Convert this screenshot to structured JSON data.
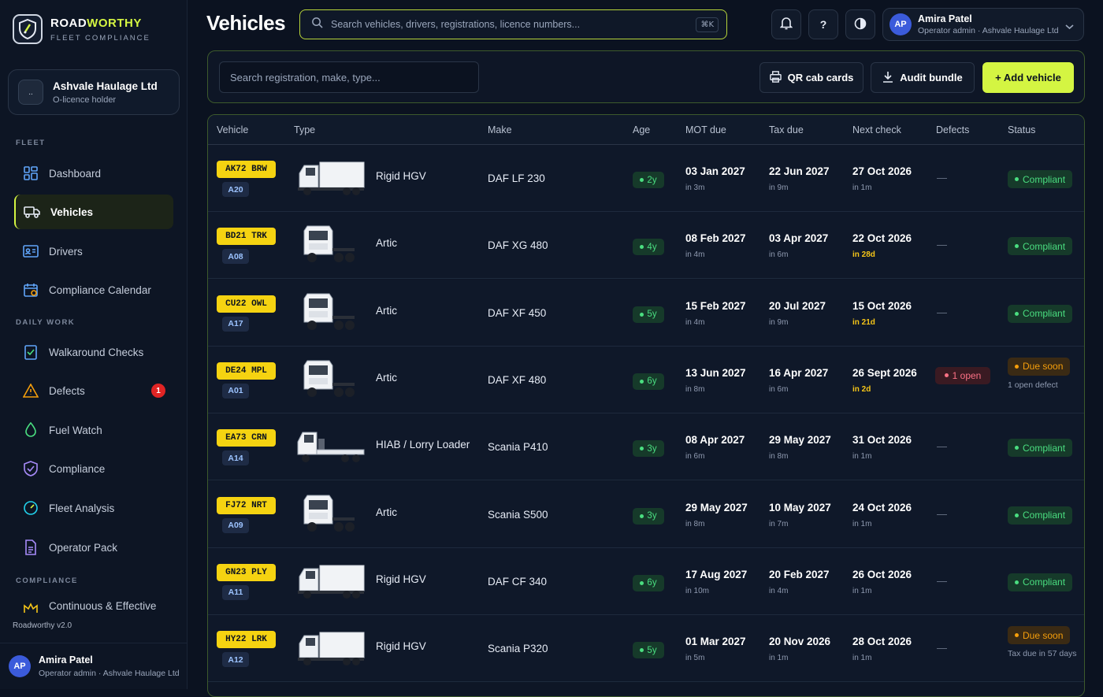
{
  "brand": {
    "name_main": "ROAD",
    "name_accent": "WORTHY",
    "subtitle": "FLEET COMPLIANCE"
  },
  "org": {
    "avatar": "..",
    "name": "Ashvale Haulage Ltd",
    "role": "O-licence holder"
  },
  "nav": {
    "sections": [
      "FLEET",
      "DAILY WORK",
      "COMPLIANCE"
    ],
    "items": [
      {
        "label": "Dashboard",
        "icon": "dashboard-icon"
      },
      {
        "label": "Vehicles",
        "icon": "truck-icon"
      },
      {
        "label": "Drivers",
        "icon": "id-card-icon"
      },
      {
        "label": "Compliance Calendar",
        "icon": "calendar-icon"
      },
      {
        "label": "Walkaround Checks",
        "icon": "checklist-icon"
      },
      {
        "label": "Defects",
        "icon": "warning-icon",
        "badge": "1"
      },
      {
        "label": "Fuel Watch",
        "icon": "droplet-icon"
      },
      {
        "label": "Compliance",
        "icon": "shield-icon"
      },
      {
        "label": "Fleet Analysis",
        "icon": "gauge-icon"
      },
      {
        "label": "Operator Pack",
        "icon": "document-icon"
      },
      {
        "label": "Continuous & Effective",
        "icon": "crown-icon"
      }
    ]
  },
  "version": "Roadworthy v2.0",
  "user": {
    "initials": "AP",
    "name": "Amira Patel",
    "role": "Operator admin · Ashvale Haulage Ltd"
  },
  "header": {
    "title": "Vehicles",
    "search_placeholder": "Search vehicles, drivers, registrations, licence numbers...",
    "shortcut": "⌘K",
    "help": "?"
  },
  "toolbar": {
    "search_placeholder": "Search registration, make, type...",
    "qr_label": "QR cab cards",
    "audit_label": "Audit bundle",
    "add_label": "+ Add vehicle"
  },
  "table": {
    "columns": [
      "Vehicle",
      "Type",
      "Make",
      "Age",
      "MOT due",
      "Tax due",
      "Next check",
      "Defects",
      "Status"
    ],
    "rows": [
      {
        "reg": "AK72 BRW",
        "fleet": "A20",
        "type": "Rigid HGV",
        "truck": "rigid",
        "make": "DAF LF 230",
        "age": "2y",
        "mot": "03 Jan 2027",
        "mot_sub": "in 3m",
        "tax": "22 Jun 2027",
        "tax_sub": "in 9m",
        "check": "27 Oct 2026",
        "check_sub": "in 1m",
        "check_warn": false,
        "defects": "—",
        "status": "Compliant",
        "status_kind": "ok",
        "note": ""
      },
      {
        "reg": "BD21 TRK",
        "fleet": "A08",
        "type": "Artic",
        "truck": "artic",
        "make": "DAF XG 480",
        "age": "4y",
        "mot": "08 Feb 2027",
        "mot_sub": "in 4m",
        "tax": "03 Apr 2027",
        "tax_sub": "in 6m",
        "check": "22 Oct 2026",
        "check_sub": "in 28d",
        "check_warn": true,
        "defects": "—",
        "status": "Compliant",
        "status_kind": "ok",
        "note": ""
      },
      {
        "reg": "CU22 OWL",
        "fleet": "A17",
        "type": "Artic",
        "truck": "artic",
        "make": "DAF XF 450",
        "age": "5y",
        "mot": "15 Feb 2027",
        "mot_sub": "in 4m",
        "tax": "20 Jul 2027",
        "tax_sub": "in 9m",
        "check": "15 Oct 2026",
        "check_sub": "in 21d",
        "check_warn": true,
        "defects": "—",
        "status": "Compliant",
        "status_kind": "ok",
        "note": ""
      },
      {
        "reg": "DE24 MPL",
        "fleet": "A01",
        "type": "Artic",
        "truck": "artic",
        "make": "DAF XF 480",
        "age": "6y",
        "mot": "13 Jun 2027",
        "mot_sub": "in 8m",
        "tax": "16 Apr 2027",
        "tax_sub": "in 6m",
        "check": "26 Sept 2026",
        "check_sub": "in 2d",
        "check_warn": true,
        "defects": "1 open",
        "status": "Due soon",
        "status_kind": "due",
        "note": "1 open defect"
      },
      {
        "reg": "EA73 CRN",
        "fleet": "A14",
        "type": "HIAB / Lorry Loader",
        "truck": "flatbed",
        "make": "Scania P410",
        "age": "3y",
        "mot": "08 Apr 2027",
        "mot_sub": "in 6m",
        "tax": "29 May 2027",
        "tax_sub": "in 8m",
        "check": "31 Oct 2026",
        "check_sub": "in 1m",
        "check_warn": false,
        "defects": "—",
        "status": "Compliant",
        "status_kind": "ok",
        "note": ""
      },
      {
        "reg": "FJ72 NRT",
        "fleet": "A09",
        "type": "Artic",
        "truck": "artic",
        "make": "Scania S500",
        "age": "3y",
        "mot": "29 May 2027",
        "mot_sub": "in 8m",
        "tax": "10 May 2027",
        "tax_sub": "in 7m",
        "check": "24 Oct 2026",
        "check_sub": "in 1m",
        "check_warn": false,
        "defects": "—",
        "status": "Compliant",
        "status_kind": "ok",
        "note": ""
      },
      {
        "reg": "GN23 PLY",
        "fleet": "A11",
        "type": "Rigid HGV",
        "truck": "rigid",
        "make": "DAF CF 340",
        "age": "6y",
        "mot": "17 Aug 2027",
        "mot_sub": "in 10m",
        "tax": "20 Feb 2027",
        "tax_sub": "in 4m",
        "check": "26 Oct 2026",
        "check_sub": "in 1m",
        "check_warn": false,
        "defects": "—",
        "status": "Compliant",
        "status_kind": "ok",
        "note": ""
      },
      {
        "reg": "HY22 LRK",
        "fleet": "A12",
        "type": "Rigid HGV",
        "truck": "rigid",
        "make": "Scania P320",
        "age": "5y",
        "mot": "01 Mar 2027",
        "mot_sub": "in 5m",
        "tax": "20 Nov 2026",
        "tax_sub": "in 1m",
        "check": "28 Oct 2026",
        "check_sub": "in 1m",
        "check_warn": false,
        "defects": "—",
        "status": "Due soon",
        "status_kind": "due",
        "note": "Tax due in 57 days"
      }
    ]
  },
  "colors": {
    "accent": "#d4f542",
    "ok": "#4ade80",
    "warn": "#f59e0b",
    "danger": "#fb7185",
    "plate": "#f5d311"
  }
}
